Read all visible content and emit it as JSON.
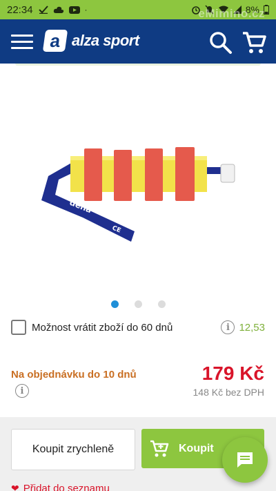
{
  "status_bar": {
    "time": "22:34",
    "battery": "8%",
    "watermark": "eMimino.cz",
    "icons": [
      "check-icon",
      "cloud-icon",
      "youtube-icon",
      "dot-icon",
      "alarm-icon",
      "mute-icon",
      "wifi-icon",
      "signal-icon",
      "battery-icon"
    ]
  },
  "app_bar": {
    "logo_mark": "a",
    "logo_text": "alza sport",
    "background": "#0f3b83"
  },
  "gallery": {
    "dot_count": 3,
    "active_index": 0
  },
  "product_image": {
    "brand_label": "dena",
    "mark": "CE"
  },
  "return_option": {
    "label": "Možnost vrátit zboží do 60 dnů",
    "price": "12,53",
    "checked": false
  },
  "availability": {
    "text": "Na objednávku do 10 dnů"
  },
  "pricing": {
    "price": "179 Kč",
    "price_excl_vat": "148 Kč bez DPH"
  },
  "actions": {
    "buy_fast_label": "Koupit zrychleně",
    "buy_label": "Koupit",
    "wishlist_label": "Přidat do seznamu"
  },
  "colors": {
    "brand_green": "#8dc63f",
    "price_red": "#d9142a",
    "availability_orange": "#c96f23"
  }
}
